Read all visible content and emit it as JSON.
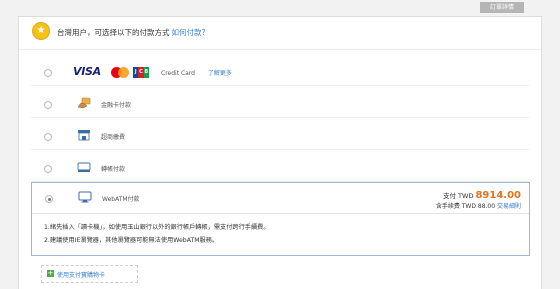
{
  "order_details_button": "訂單詳情",
  "header": {
    "text": "台灣用户，可选择以下的付款方式",
    "link": "如何付款?"
  },
  "methods": [
    {
      "label": "Credit Card",
      "link": "了解更多"
    },
    {
      "label": "金融卡付款"
    },
    {
      "label": "超商繳費"
    },
    {
      "label": "轉帳付款"
    },
    {
      "label": "WebATM付款"
    }
  ],
  "payment": {
    "pay_label": "支付 TWD",
    "amount": "8914.00",
    "fee_label": "含手续费 TWD 88.00",
    "fee_link": "交易細則"
  },
  "notes": [
    "1.緒先插入「讀卡機」，如使用玉山銀行以外的銀行帳戶轉帳，需支付跨行手續費。",
    "2.建議使用IE瀏覽器，其他瀏覽器可能無法使用WebATM服務。"
  ],
  "coupon": "使用支付寶購物卡",
  "colors": {
    "accent_orange": "#e9701b",
    "link_blue": "#3a7fcf",
    "selected_border": "#9bb8d6",
    "coupon_green": "#4fae3a"
  },
  "icons": [
    "coin-star-icon",
    "visa-logo",
    "mastercard-logo",
    "jcb-logo",
    "hand-card-icon",
    "store-icon",
    "bank-transfer-icon",
    "monitor-icon",
    "plus-icon"
  ]
}
